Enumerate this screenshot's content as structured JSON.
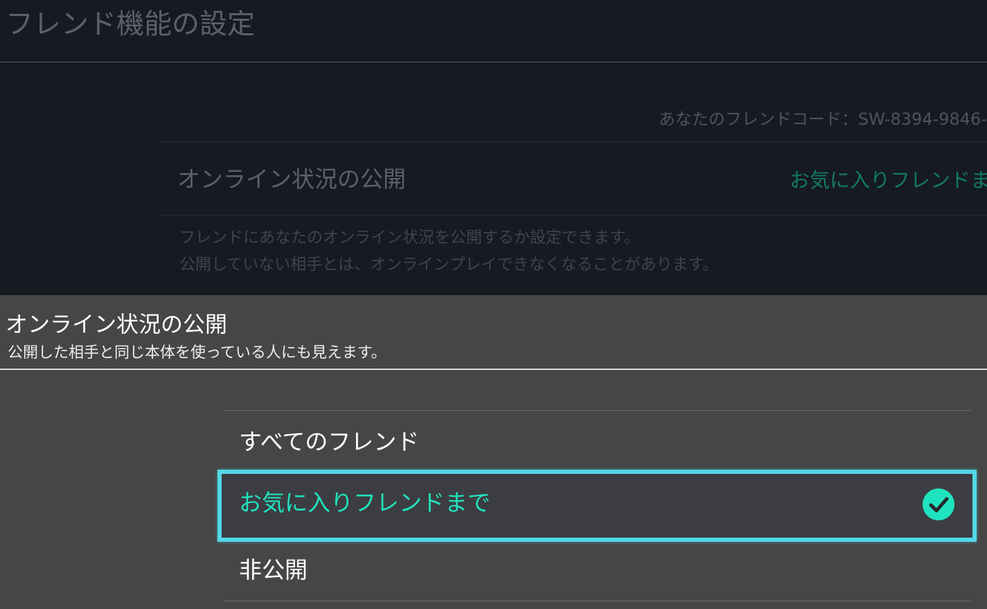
{
  "background": {
    "title": "フレンド機能の設定",
    "friend_code": "あなたのフレンドコード：SW-8394-9846-",
    "setting_label": "オンライン状況の公開",
    "setting_value": "お気に入りフレンドま",
    "description_line1": "フレンドにあなたのオンライン状況を公開するか設定できます。",
    "description_line2": "公開していない相手とは、オンラインプレイできなくなることがあります。"
  },
  "popup": {
    "title": "オンライン状況の公開",
    "subtitle": "公開した相手と同じ本体を使っている人にも見えます。",
    "options": [
      {
        "label": "すべてのフレンド",
        "selected": false
      },
      {
        "label": "お気に入りフレンドまで",
        "selected": true
      },
      {
        "label": "非公開",
        "selected": false
      }
    ]
  },
  "colors": {
    "accent": "#1fe3be",
    "focus_border": "#51d8e6",
    "panel_bg": "#464646",
    "page_bg": "#161a21"
  }
}
